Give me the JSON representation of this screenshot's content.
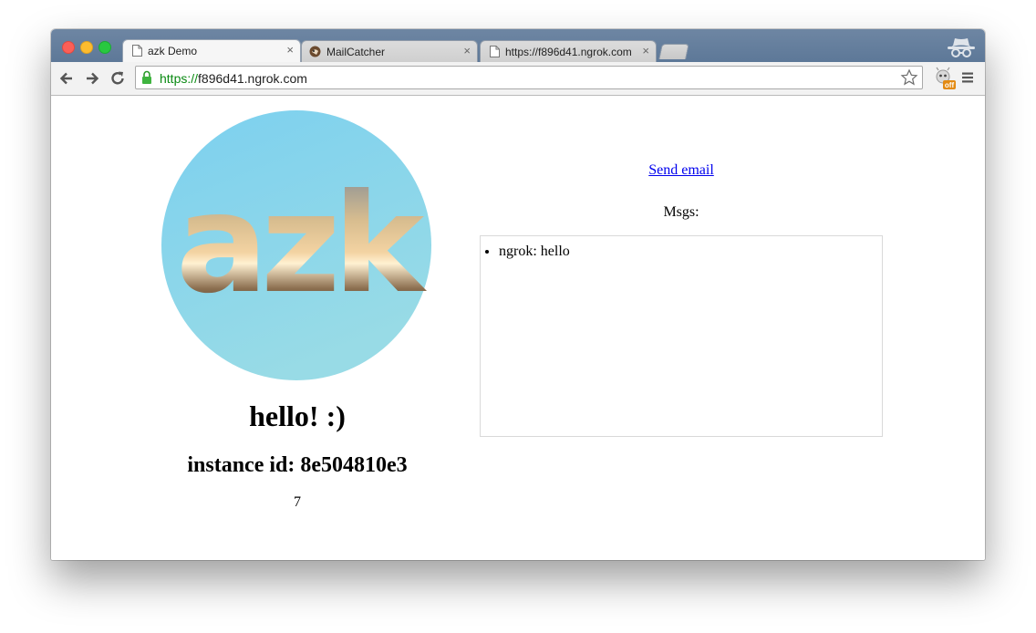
{
  "browser": {
    "tabs": [
      {
        "title": "azk Demo",
        "active": true
      },
      {
        "title": "MailCatcher",
        "active": false
      },
      {
        "title": "https://f896d41.ngrok.com",
        "active": false
      }
    ],
    "close_glyph": "×",
    "url_scheme": "https://",
    "url_host": "f896d41.ngrok.com",
    "extension_badge": "off",
    "colors": {
      "scheme": "#0a8a12",
      "tabstrip": "#5d7898",
      "link": "#0000ee"
    }
  },
  "page": {
    "logo_text": "azk",
    "heading": "hello! :)",
    "instance_id": "instance id: 8e504810e3",
    "counter": "7",
    "send_email_link": "Send email",
    "msgs_label": "Msgs:",
    "messages": [
      "ngrok: hello"
    ]
  }
}
